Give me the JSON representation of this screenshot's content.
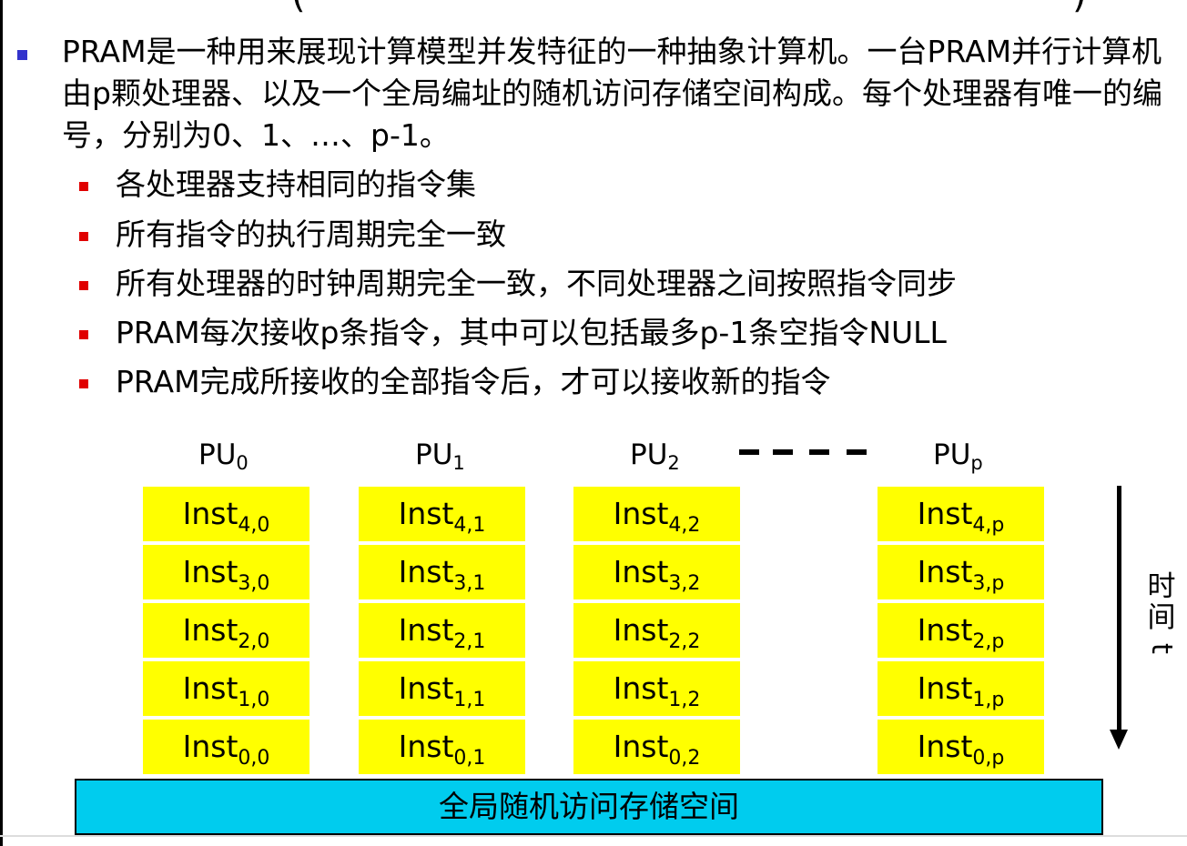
{
  "title_fragment": {
    "left_paren": "(",
    "right_paren": ")"
  },
  "intro": "PRAM是一种用来展现计算模型并发特征的一种抽象计算机。一台PRAM并行计算机由p颗处理器、以及一个全局编址的随机访问存储空间构成。每个处理器有唯一的编号，分别为0、1、…、p-1。",
  "sub_items": [
    "各处理器支持相同的指令集",
    "所有指令的执行周期完全一致",
    "所有处理器的时钟周期完全一致，不同处理器之间按照指令同步",
    "PRAM每次接收p条指令，其中可以包括最多p-1条空指令NULL",
    "PRAM完成所接收的全部指令后，才可以接收新的指令"
  ],
  "diagram": {
    "pu_base": "PU",
    "pu_indices": [
      "0",
      "1",
      "2",
      "p"
    ],
    "inst_base": "Inst",
    "columns": [
      {
        "pu_index": "0",
        "instr_subs": [
          "4,0",
          "3,0",
          "2,0",
          "1,0",
          "0,0"
        ]
      },
      {
        "pu_index": "1",
        "instr_subs": [
          "4,1",
          "3,1",
          "2,1",
          "1,1",
          "0,1"
        ]
      },
      {
        "pu_index": "2",
        "instr_subs": [
          "4,2",
          "3,2",
          "2,2",
          "1,2",
          "0,2"
        ]
      },
      {
        "pu_index": "p",
        "instr_subs": [
          "4,p",
          "3,p",
          "2,p",
          "1,p",
          "0,p"
        ]
      }
    ],
    "memory_label": "全局随机访问存储空间",
    "time_chars": [
      "时",
      "间"
    ],
    "time_var": "t"
  },
  "colors": {
    "cell_fill": "#ffff00",
    "memory_fill": "#00ccee",
    "bullet_l1": "#3333cc",
    "bullet_l2": "#e00000"
  }
}
